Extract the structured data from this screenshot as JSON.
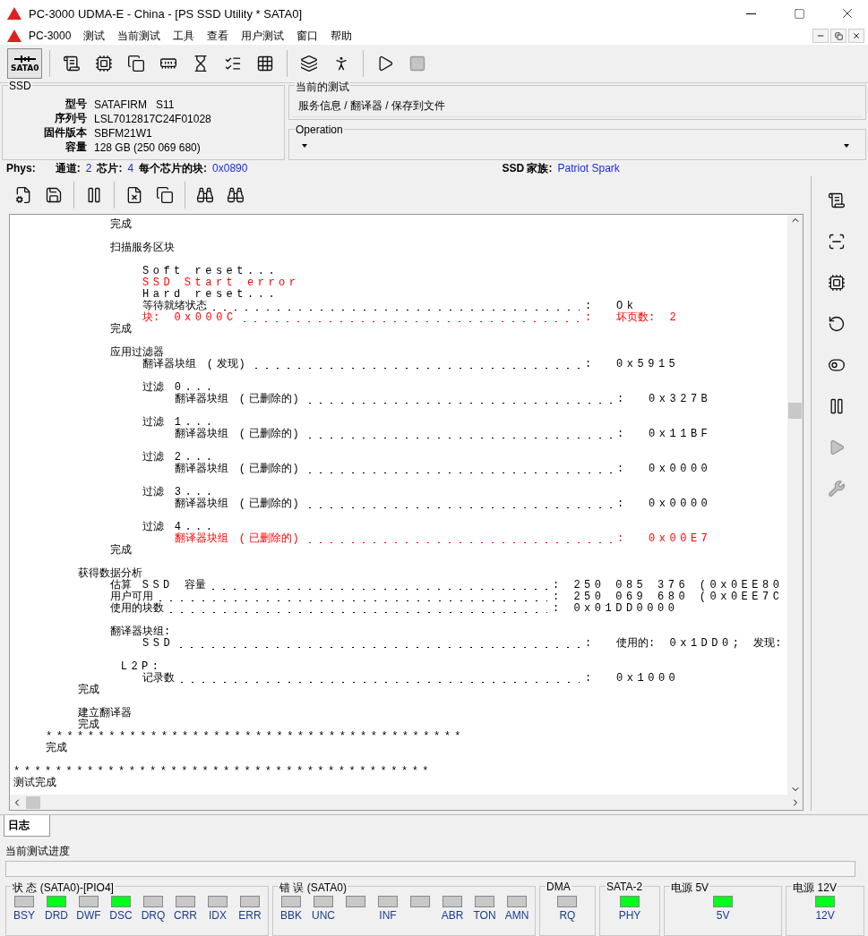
{
  "window": {
    "title": "PC-3000 UDMA-E - China - [PS SSD Utility * SATA0]"
  },
  "menu": [
    "PC-3000",
    "测试",
    "当前测试",
    "工具",
    "查看",
    "用户测试",
    "窗口",
    "帮助"
  ],
  "toolbar": [
    {
      "kind": "port",
      "label": "SATA0",
      "selected": true,
      "disabled": false
    },
    {
      "kind": "info",
      "disabled": false
    },
    {
      "kind": "chip",
      "disabled": false
    },
    {
      "kind": "copy",
      "disabled": false
    },
    {
      "kind": "board",
      "disabled": false
    },
    {
      "kind": "hourglass",
      "disabled": false
    },
    {
      "kind": "list",
      "disabled": false
    },
    {
      "kind": "grid",
      "disabled": false
    },
    {
      "kind": "windows",
      "disabled": false
    },
    {
      "kind": "runner",
      "disabled": false
    },
    {
      "kind": "play",
      "disabled": false
    },
    {
      "kind": "stop",
      "disabled": true
    }
  ],
  "ssd": {
    "title": "SSD",
    "fields": [
      {
        "label": "型号",
        "value": "SATAFIRM   S11"
      },
      {
        "label": "序列号",
        "value": "LSL7012817C24F01028"
      },
      {
        "label": "固件版本",
        "value": "SBFM21W1"
      },
      {
        "label": "容量",
        "value": "128 GB (250 069 680)"
      }
    ]
  },
  "current_test": {
    "title": "当前的测试",
    "value": "服务信息 / 翻译器 / 保存到文件"
  },
  "operation": {
    "title": "Operation"
  },
  "phys": {
    "label": "Phys:",
    "items": [
      {
        "label": "通道:",
        "value": "2"
      },
      {
        "label": "芯片:",
        "value": "4"
      },
      {
        "label": "每个芯片的块:",
        "value": "0x0890"
      }
    ],
    "family_label": "SSD 家族:",
    "family": "Patriot Spark"
  },
  "child_toolbar": [
    {
      "kind": "gear-doc",
      "disabled": false
    },
    {
      "kind": "save",
      "disabled": false
    },
    {
      "kind": "pause",
      "disabled": false
    },
    {
      "kind": "save-x",
      "disabled": false
    },
    {
      "kind": "copy",
      "disabled": false
    },
    {
      "kind": "binoculars",
      "disabled": false
    },
    {
      "kind": "binoculars",
      "disabled": false
    }
  ],
  "side_toolbar": [
    {
      "kind": "info",
      "disabled": false
    },
    {
      "kind": "zero",
      "disabled": false
    },
    {
      "kind": "chip",
      "disabled": false
    },
    {
      "kind": "reset",
      "disabled": false
    },
    {
      "kind": "switch",
      "disabled": false
    },
    {
      "kind": "pause",
      "disabled": false
    },
    {
      "kind": "play-chip",
      "disabled": true
    },
    {
      "kind": "tools",
      "disabled": true
    }
  ],
  "log": [
    {
      "kind": "group",
      "children": [
        {
          "kind": "group",
          "children": [
            {
              "kind": "group",
              "children": [
                {
                  "kind": "text",
                  "text": "完成",
                  "error": false
                },
                {
                  "kind": "gap"
                },
                {
                  "kind": "text",
                  "text": "扫描服务区块",
                  "error": false
                },
                {
                  "kind": "gap"
                },
                {
                  "kind": "group",
                  "children": [
                    {
                      "kind": "text",
                      "text": "Soft reset...",
                      "error": false
                    },
                    {
                      "kind": "text",
                      "text": "SSD Start error",
                      "error": true
                    },
                    {
                      "kind": "text",
                      "text": "Hard reset...",
                      "error": false
                    },
                    {
                      "kind": "leader",
                      "label": "等待就绪状态",
                      "value": ":  Ok",
                      "error": false
                    },
                    {
                      "kind": "leader",
                      "label": "块: 0x000C",
                      "value": ":  坏页数: 2",
                      "error": true
                    }
                  ]
                },
                {
                  "kind": "text",
                  "text": "完成",
                  "error": false
                },
                {
                  "kind": "gap"
                },
                {
                  "kind": "text",
                  "text": "应用过滤器",
                  "error": false
                },
                {
                  "kind": "group",
                  "children": [
                    {
                      "kind": "leader",
                      "label": "翻译器块组 (发现)",
                      "value": ":  0x5915",
                      "error": false
                    },
                    {
                      "kind": "gap"
                    },
                    {
                      "kind": "text",
                      "text": "过滤 0...",
                      "error": false
                    },
                    {
                      "kind": "group",
                      "children": [
                        {
                          "kind": "leader",
                          "label": "翻译器块组 (已删除的)",
                          "value": ":  0x327B",
                          "error": false
                        }
                      ]
                    },
                    {
                      "kind": "gap"
                    },
                    {
                      "kind": "text",
                      "text": "过滤 1...",
                      "error": false
                    },
                    {
                      "kind": "group",
                      "children": [
                        {
                          "kind": "leader",
                          "label": "翻译器块组 (已删除的)",
                          "value": ":  0x11BF",
                          "error": false
                        }
                      ]
                    },
                    {
                      "kind": "gap"
                    },
                    {
                      "kind": "text",
                      "text": "过滤 2...",
                      "error": false
                    },
                    {
                      "kind": "group",
                      "children": [
                        {
                          "kind": "leader",
                          "label": "翻译器块组 (已删除的)",
                          "value": ":  0x0000",
                          "error": false
                        }
                      ]
                    },
                    {
                      "kind": "gap"
                    },
                    {
                      "kind": "text",
                      "text": "过滤 3...",
                      "error": false
                    },
                    {
                      "kind": "group",
                      "children": [
                        {
                          "kind": "leader",
                          "label": "翻译器块组 (已删除的)",
                          "value": ":  0x0000",
                          "error": false
                        }
                      ]
                    },
                    {
                      "kind": "gap"
                    },
                    {
                      "kind": "text",
                      "text": "过滤 4...",
                      "error": false
                    },
                    {
                      "kind": "group",
                      "children": [
                        {
                          "kind": "leader",
                          "label": "翻译器块组 (已删除的)",
                          "value": ":  0x00E7",
                          "error": true
                        }
                      ]
                    }
                  ]
                },
                {
                  "kind": "text",
                  "text": "完成",
                  "error": false
                }
              ]
            },
            {
              "kind": "gap"
            },
            {
              "kind": "text",
              "text": "获得数据分析",
              "error": false
            },
            {
              "kind": "group",
              "children": [
                {
                  "kind": "leader",
                  "label": "估算 SSD 容量",
                  "value": ": 250 085 376 (0x0EE80",
                  "error": false
                },
                {
                  "kind": "leader",
                  "label": "用户可用",
                  "value": ": 250 069 680 (0x0EE7C",
                  "error": false
                },
                {
                  "kind": "leader",
                  "label": "使用的块数",
                  "value": ": 0x01DD0000",
                  "error": false
                },
                {
                  "kind": "gap"
                },
                {
                  "kind": "text",
                  "text": "翻译器块组:",
                  "error": false
                },
                {
                  "kind": "group",
                  "children": [
                    {
                      "kind": "leader",
                      "label": "SSD",
                      "value": ":  使用的: 0x1DD0; 发现:",
                      "error": false
                    }
                  ]
                },
                {
                  "kind": "gap"
                },
                {
                  "kind": "text",
                  "text": " L2P:",
                  "error": false
                },
                {
                  "kind": "group",
                  "children": [
                    {
                      "kind": "leader",
                      "label": "记录数",
                      "value": ":  0x1000",
                      "error": false
                    }
                  ]
                }
              ]
            },
            {
              "kind": "text",
              "text": "完成",
              "error": false
            },
            {
              "kind": "gap"
            },
            {
              "kind": "text",
              "text": "建立翻译器",
              "error": false
            },
            {
              "kind": "text",
              "text": "完成",
              "error": false
            }
          ]
        },
        {
          "kind": "text",
          "text": "****************************************",
          "error": false
        },
        {
          "kind": "text",
          "text": "完成",
          "error": false
        }
      ]
    },
    {
      "kind": "gap"
    },
    {
      "kind": "text",
      "text": "****************************************",
      "error": false
    },
    {
      "kind": "text",
      "text": "测试完成",
      "error": false
    }
  ],
  "tabs": [
    {
      "label": "日志",
      "selected": true
    }
  ],
  "progress": {
    "label": "当前测试进度",
    "level": 0
  },
  "status_groups": [
    {
      "title": "状 态 (SATA0)-[PIO4]",
      "leds": [
        {
          "label": "BSY",
          "on": false
        },
        {
          "label": "DRD",
          "on": true
        },
        {
          "label": "DWF",
          "on": false
        },
        {
          "label": "DSC",
          "on": true
        },
        {
          "label": "DRQ",
          "on": false
        },
        {
          "label": "CRR",
          "on": false
        },
        {
          "label": "IDX",
          "on": false
        },
        {
          "label": "ERR",
          "on": false
        }
      ]
    },
    {
      "title": "错 误 (SATA0)",
      "leds": [
        {
          "label": "BBK",
          "on": false
        },
        {
          "label": "UNC",
          "on": false
        },
        {
          "on": false
        },
        {
          "label": "INF",
          "on": false
        },
        {
          "on": false
        },
        {
          "label": "ABR",
          "on": false
        },
        {
          "label": "TON",
          "on": false
        },
        {
          "label": "AMN",
          "on": false
        }
      ]
    },
    {
      "title": "DMA",
      "leds": [
        {
          "label": "RQ",
          "on": false
        }
      ]
    },
    {
      "title": "SATA-2",
      "leds": [
        {
          "label": "PHY",
          "on": true
        }
      ]
    },
    {
      "title": "电源 5V",
      "leds": [
        {
          "label": "5V",
          "on": true
        }
      ]
    },
    {
      "title": "电源 12V",
      "leds": [
        {
          "label": "12V",
          "on": true
        }
      ]
    }
  ]
}
